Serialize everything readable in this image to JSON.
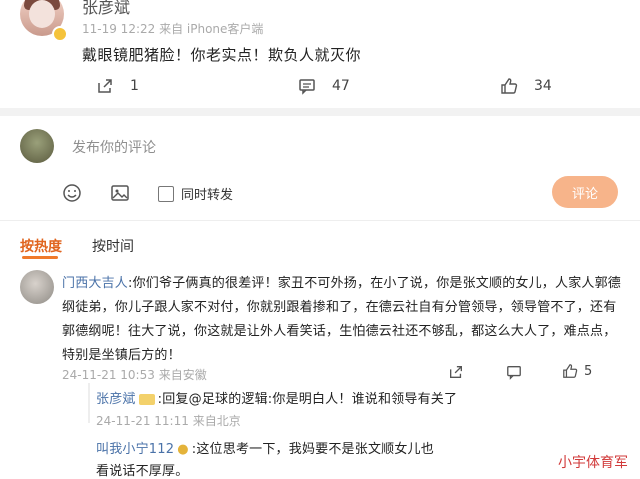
{
  "post": {
    "author": "张彦斌",
    "time": "11-19 12:22",
    "source": "来自 iPhone客户端",
    "text": "戴眼镜肥猪脸！你老实点！欺负人就灭你",
    "share_count": "1",
    "comment_count": "47",
    "like_count": "34"
  },
  "composer": {
    "placeholder": "发布你的评论",
    "repost_label": "同时转发",
    "submit_label": "评论"
  },
  "tabs": {
    "hot": "按热度",
    "time": "按时间"
  },
  "comment": {
    "author": "门西大吉人",
    "lines": [
      ":你们爷子俩真的很差评！家丑不可外扬，在小了说，你是张文顺的女儿，人家人郭德",
      "纲徒弟，你儿子跟人家不对付，你就别跟着掺和了，在德云社自有分管领导，领导管不了，还有",
      "郭德纲呢！往大了说，你这就是让外人看笑话，生怕德云社还不够乱，都这么大人了，难点点，",
      "特别是坐镇后方的！"
    ],
    "time": "24-11-21 10:53",
    "source": "来自安徽",
    "like_count": "5"
  },
  "replies": [
    {
      "author": "张彦斌",
      "text": ":回复@足球的逻辑:你是明白人！谁说和领导有关了",
      "time": "24-11-21 11:11",
      "source": "来自北京"
    },
    {
      "author": "叫我小宁112",
      "text": ":这位思考一下，我妈要不是张文顺女儿也",
      "text2": "看说话不厚厚。"
    }
  ],
  "watermark": "小宇体育军",
  "colors": {
    "accent": "#f07a2a",
    "link": "#4a72a8",
    "submit_bg": "#f7b48a"
  }
}
